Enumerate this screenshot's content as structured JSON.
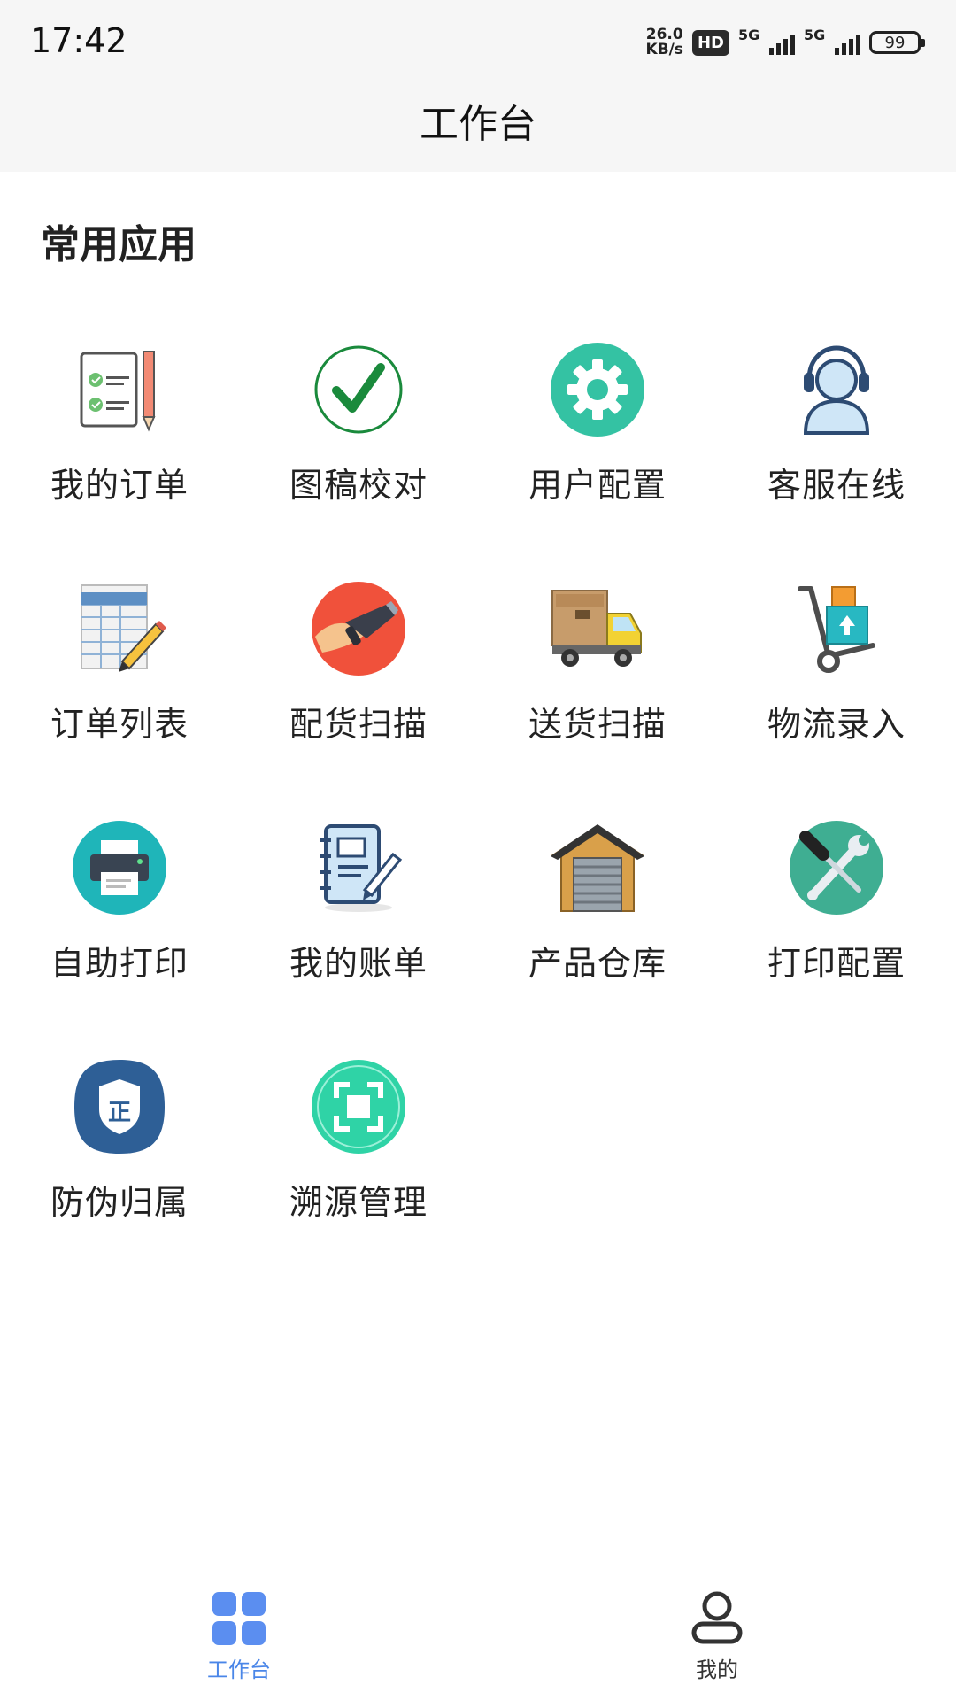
{
  "status_bar": {
    "time": "17:42",
    "net_speed_value": "26.0",
    "net_speed_unit": "KB/s",
    "hd_badge": "HD",
    "signal1_label": "5G",
    "signal2_label": "5G",
    "battery": "99"
  },
  "header": {
    "title": "工作台"
  },
  "section": {
    "title": "常用应用"
  },
  "apps": [
    {
      "label": "我的订单",
      "icon": "order-checklist-icon"
    },
    {
      "label": "图稿校对",
      "icon": "checkmark-circle-icon"
    },
    {
      "label": "用户配置",
      "icon": "gear-icon"
    },
    {
      "label": "客服在线",
      "icon": "headset-agent-icon"
    },
    {
      "label": "订单列表",
      "icon": "spreadsheet-pencil-icon"
    },
    {
      "label": "配货扫描",
      "icon": "barcode-scanner-icon"
    },
    {
      "label": "送货扫描",
      "icon": "delivery-truck-icon"
    },
    {
      "label": "物流录入",
      "icon": "hand-truck-icon"
    },
    {
      "label": "自助打印",
      "icon": "printer-icon"
    },
    {
      "label": "我的账单",
      "icon": "notebook-pen-icon"
    },
    {
      "label": "产品仓库",
      "icon": "warehouse-icon"
    },
    {
      "label": "打印配置",
      "icon": "wrench-screwdriver-icon"
    },
    {
      "label": "防伪归属",
      "icon": "shield-icon"
    },
    {
      "label": "溯源管理",
      "icon": "scan-frame-icon"
    }
  ],
  "bottom_nav": {
    "workbench_label": "工作台",
    "mine_label": "我的",
    "active_color": "#4a86e8",
    "inactive_color": "#333333"
  }
}
